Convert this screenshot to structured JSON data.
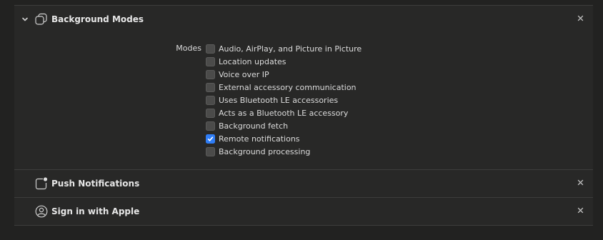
{
  "capabilities": [
    {
      "title": "Background Modes",
      "icon": "background-modes-icon",
      "expanded": true
    },
    {
      "title": "Push Notifications",
      "icon": "push-notifications-icon",
      "expanded": false
    },
    {
      "title": "Sign in with Apple",
      "icon": "sign-in-with-apple-icon",
      "expanded": false
    }
  ],
  "background_modes": {
    "label": "Modes",
    "options": [
      {
        "label": "Audio, AirPlay, and Picture in Picture",
        "checked": false
      },
      {
        "label": "Location updates",
        "checked": false
      },
      {
        "label": "Voice over IP",
        "checked": false
      },
      {
        "label": "External accessory communication",
        "checked": false
      },
      {
        "label": "Uses Bluetooth LE accessories",
        "checked": false
      },
      {
        "label": "Acts as a Bluetooth LE accessory",
        "checked": false
      },
      {
        "label": "Background fetch",
        "checked": false
      },
      {
        "label": "Remote notifications",
        "checked": true
      },
      {
        "label": "Background processing",
        "checked": false
      }
    ]
  },
  "colors": {
    "background": "#222221",
    "separator": "#3d3d3c",
    "accent": "#2f7df6"
  }
}
